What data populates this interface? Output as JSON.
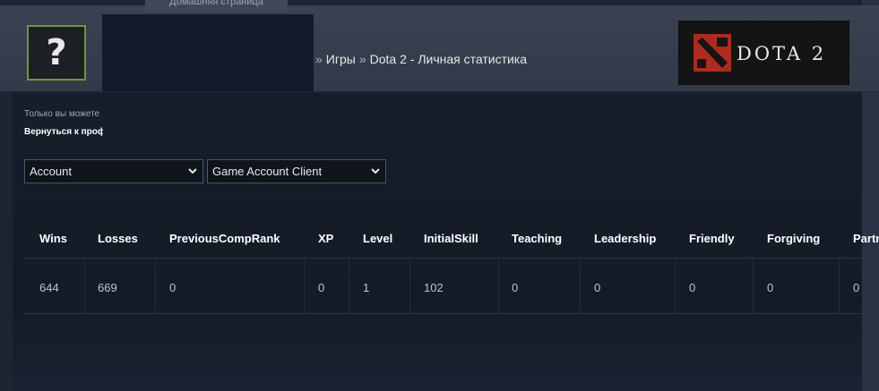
{
  "header": {
    "top_tab_label": "Домашняя страница",
    "avatar_glyph": "?",
    "breadcrumb": {
      "items": [
        "Игры",
        "Dota 2 - Личная статистика"
      ],
      "separator": "»"
    },
    "logo_text": "DOTA 2"
  },
  "notice": {
    "text": "Только вы можете",
    "back_link": "Вернуться к профилю"
  },
  "filters": {
    "account_select": "Account",
    "client_select": "Game Account Client"
  },
  "table": {
    "columns": [
      "Wins",
      "Losses",
      "PreviousCompRank",
      "XP",
      "Level",
      "InitialSkill",
      "Teaching",
      "Leadership",
      "Friendly",
      "Forgiving",
      "Partner"
    ],
    "rows": [
      [
        "644",
        "669",
        "0",
        "0",
        "1",
        "102",
        "0",
        "0",
        "0",
        "0",
        "0"
      ]
    ]
  },
  "colors": {
    "background": "#1b2331",
    "header": "#363e4d",
    "avatar_border": "#6b9a2e",
    "dota_red": "#b02a1e"
  }
}
